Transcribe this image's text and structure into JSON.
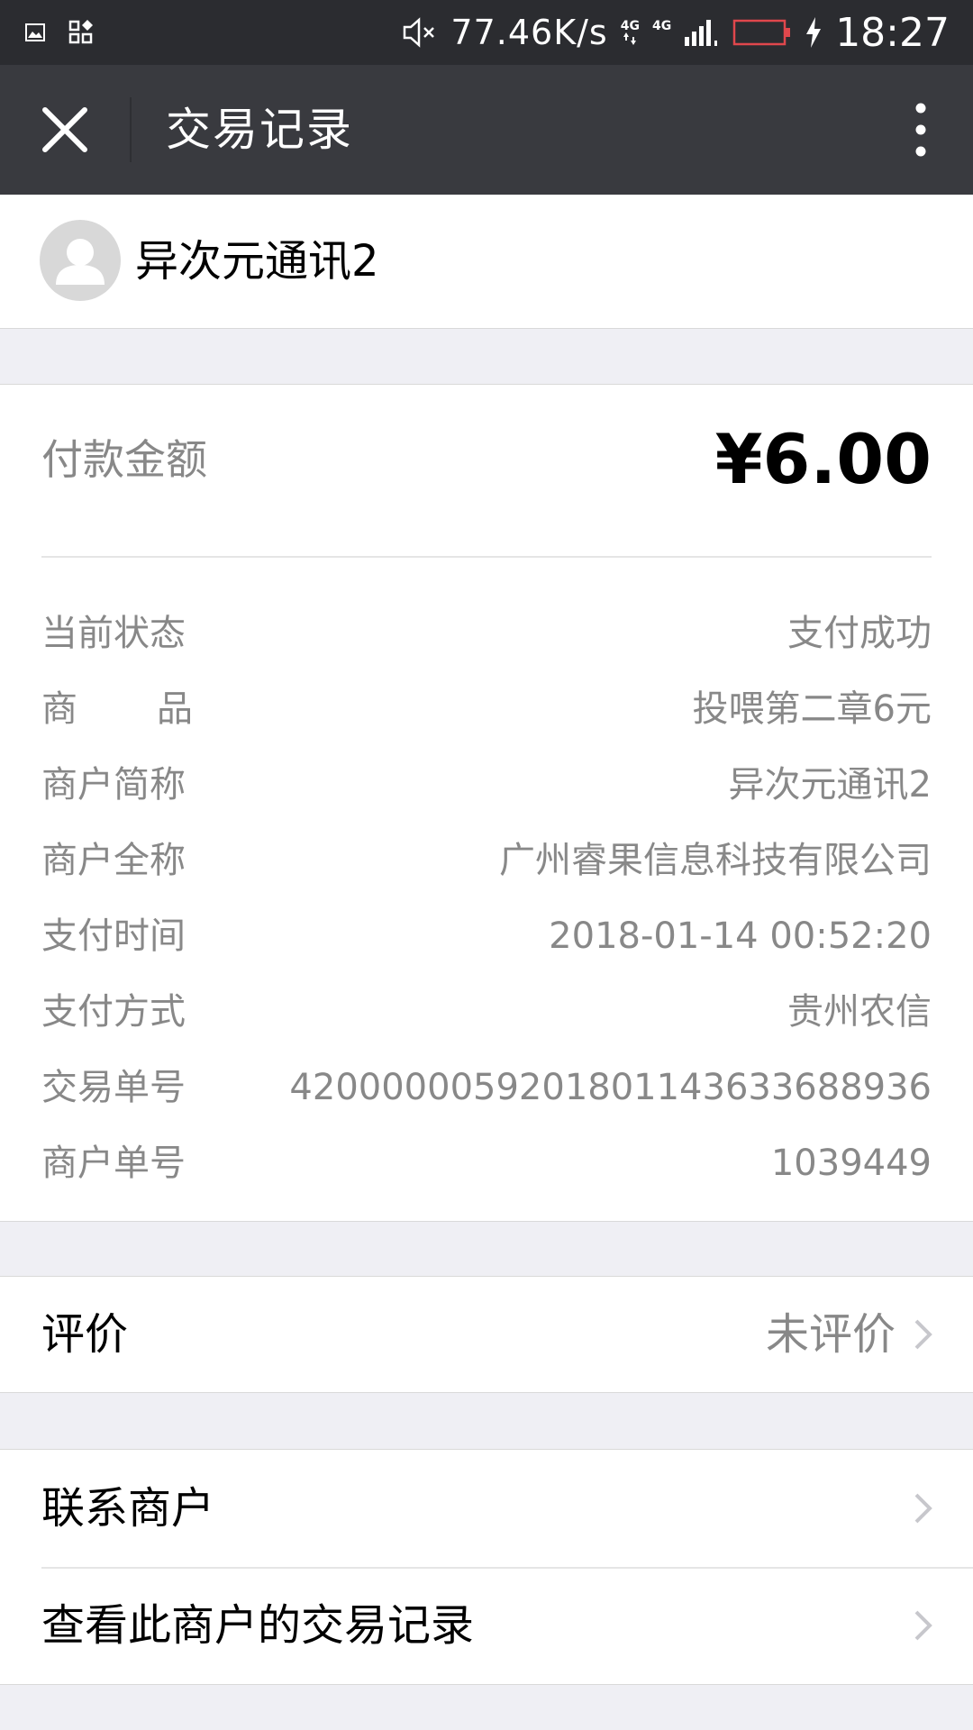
{
  "status_bar": {
    "speed": "77.46K/s",
    "network_a": "4G",
    "network_b": "4G",
    "time": "18:27"
  },
  "nav": {
    "title": "交易记录"
  },
  "merchant": {
    "name": "异次元通讯2"
  },
  "payment": {
    "amount_label": "付款金额",
    "amount": "¥6.00"
  },
  "details": [
    {
      "label": "当前状态",
      "value": "支付成功"
    },
    {
      "label": "商品",
      "value": "投喂第二章6元"
    },
    {
      "label": "商户简称",
      "value": "异次元通讯2"
    },
    {
      "label": "商户全称",
      "value": "广州睿果信息科技有限公司"
    },
    {
      "label": "支付时间",
      "value": "2018-01-14 00:52:20"
    },
    {
      "label": "支付方式",
      "value": "贵州农信"
    },
    {
      "label": "交易单号",
      "value": "4200000059201801143633688936"
    },
    {
      "label": "商户单号",
      "value": "1039449"
    }
  ],
  "rating": {
    "label": "评价",
    "value": "未评价"
  },
  "actions": {
    "contact_label": "联系商户",
    "history_label": "查看此商户的交易记录"
  },
  "colors": {
    "status_bar_bg": "#2b2c30",
    "nav_bg": "#393a3f",
    "page_bg": "#efeff4",
    "secondary_text": "#888888"
  },
  "icons": {
    "close": "close-icon",
    "more": "more-vertical-icon",
    "avatar": "user-avatar-icon",
    "chevron": "chevron-right-icon"
  }
}
